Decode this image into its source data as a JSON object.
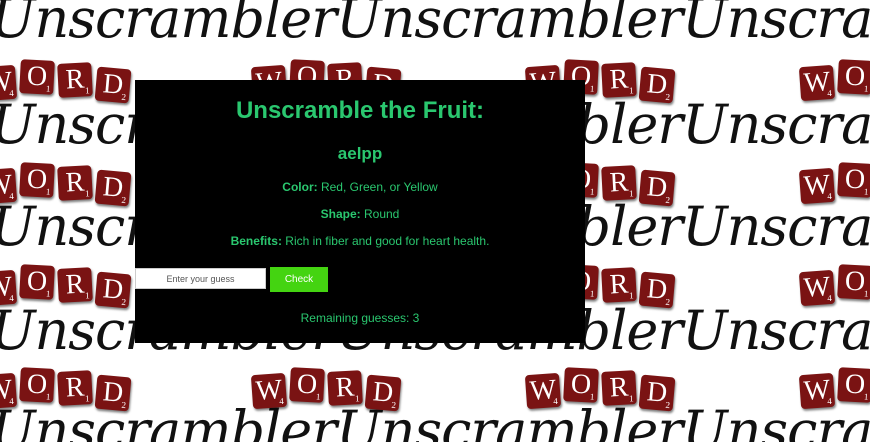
{
  "background": {
    "banner_text": "UnscramblerUnscramblerUnscramblerUnscrambler",
    "tiles": [
      {
        "letter": "W",
        "value": "4"
      },
      {
        "letter": "O",
        "value": "1"
      },
      {
        "letter": "R",
        "value": "1"
      },
      {
        "letter": "D",
        "value": "2"
      }
    ]
  },
  "game": {
    "title": "Unscramble the Fruit:",
    "scrambled_word": "aelpp",
    "hints": {
      "color_label": "Color:",
      "color_value": " Red, Green, or Yellow",
      "shape_label": "Shape:",
      "shape_value": " Round",
      "benefits_label": "Benefits:",
      "benefits_value": " Rich in fiber and good for heart health."
    },
    "guess_input": {
      "placeholder": "Enter your guess",
      "value": ""
    },
    "check_label": "Check",
    "remaining_text": "Remaining guesses: 3"
  },
  "colors": {
    "panel_bg": "#000000",
    "text_green": "#2ac76f",
    "button_green": "#44d411",
    "tile_red": "#7a1313"
  }
}
